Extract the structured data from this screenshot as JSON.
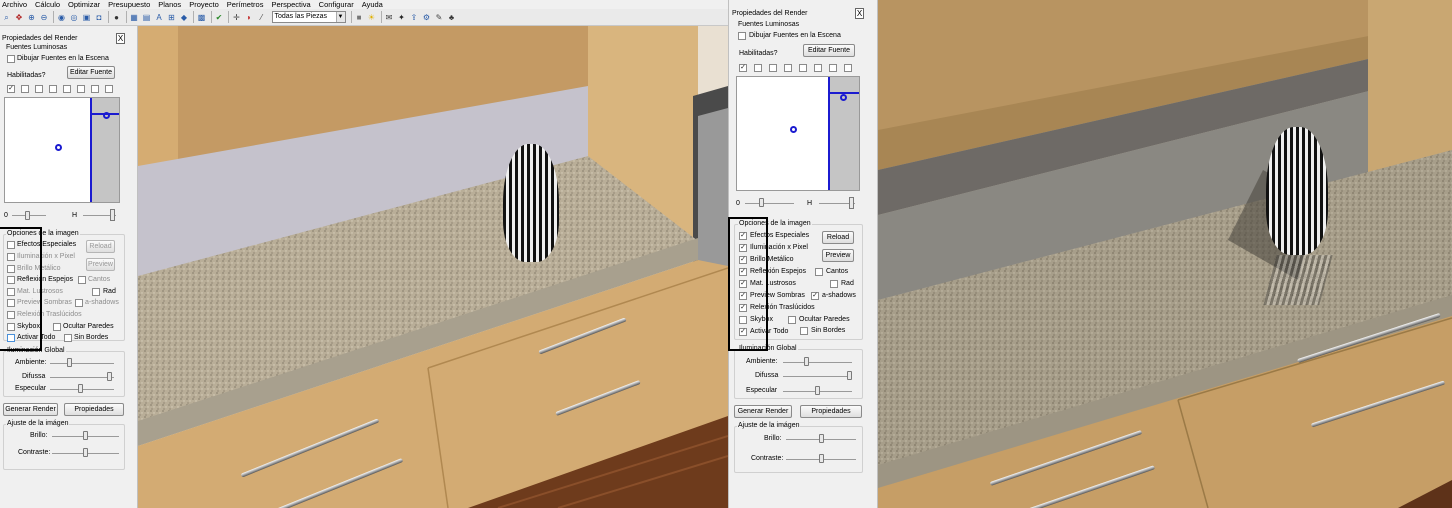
{
  "menu": [
    "Archivo",
    "Cálculo",
    "Optimizar",
    "Presupuesto",
    "Planos",
    "Proyecto",
    "Perímetros",
    "Perspectiva",
    "Configurar",
    "Ayuda"
  ],
  "toolbar": {
    "combo_value": "Todas las Piezas"
  },
  "icons": [
    "zoom-icon",
    "select-icon",
    "zoom-in-icon",
    "zoom-out-icon",
    "globe-icon",
    "render-icon",
    "photo-icon",
    "camera-icon",
    "light-icon",
    "grid-icon",
    "layers-icon",
    "text-icon",
    "measure-icon",
    "cube-icon",
    "image-icon",
    "check-icon",
    "move-icon",
    "paint-icon",
    "wand-icon",
    "lightbulb-icon",
    "mail-icon",
    "twitter-icon",
    "export-icon",
    "settings-icon",
    "pencil-icon",
    "group-icon"
  ],
  "panel": {
    "title": "Propiedades del Render",
    "close": "X",
    "light_sources": "Fuentes Luminosas",
    "draw_lights": "Dibujar Fuentes en la Escena",
    "enabled": "Habilitadas?",
    "edit_light": "Editar Fuente",
    "slider_min": "0",
    "slider_max": "H",
    "image_options": "Opciones de la imagen",
    "options": [
      "Efectos Especiales",
      "Iluminación x Pixel",
      "Brillo Metálico",
      "Reflexión Espejos",
      "Mat. Lustrosos",
      "Preview Sombras",
      "Relexión Traslúcidos",
      "Skybox",
      "Activar Todo"
    ],
    "options_right": [
      "Cantos",
      "Rad",
      "a-shadows",
      "Ocultar Paredes",
      "Sin Bordes"
    ],
    "reload": "Reload",
    "preview": "Preview",
    "global_illum": "Iluminación Global",
    "ambient": "Ambiente:",
    "diffuse": "Difussa",
    "specular": "Especular",
    "generate": "Generar Render",
    "properties": "Propiedades",
    "image_adjust": "Ajuste de la imágen",
    "brightness": "Brillo:",
    "contrast": "Contraste:"
  }
}
